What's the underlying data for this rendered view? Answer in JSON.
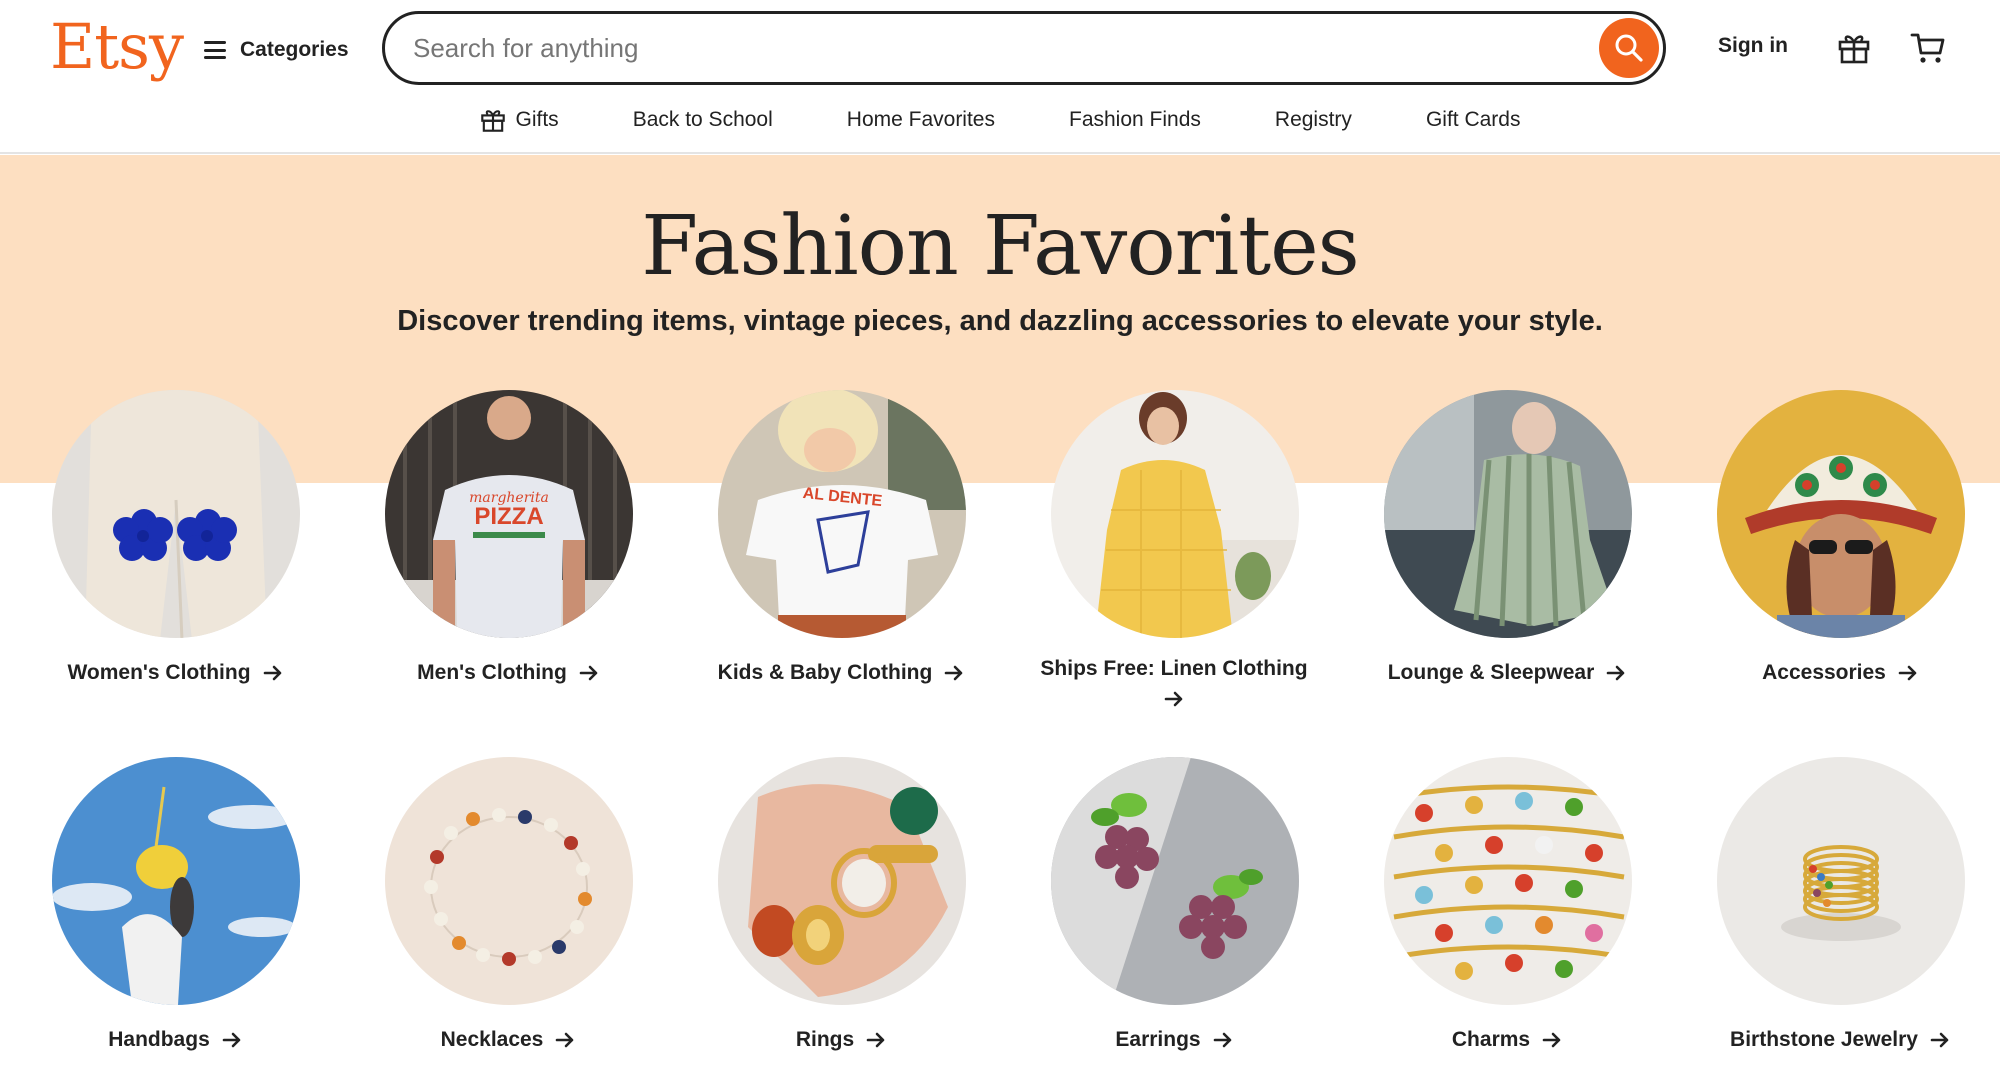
{
  "header": {
    "logo": "Etsy",
    "categories_label": "Categories",
    "search_placeholder": "Search for anything",
    "signin_label": "Sign in"
  },
  "subnav": {
    "items": [
      {
        "label": "Gifts",
        "icon": "gift-icon"
      },
      {
        "label": "Back to School"
      },
      {
        "label": "Home Favorites"
      },
      {
        "label": "Fashion Finds"
      },
      {
        "label": "Registry"
      },
      {
        "label": "Gift Cards"
      }
    ]
  },
  "hero": {
    "title": "Fashion Favorites",
    "subtitle": "Discover trending items, vintage pieces, and dazzling accessories to elevate your style."
  },
  "categories": [
    {
      "label": "Women's Clothing"
    },
    {
      "label": "Men's Clothing"
    },
    {
      "label": "Kids & Baby Clothing"
    },
    {
      "label": "Ships Free: Linen Clothing"
    },
    {
      "label": "Lounge & Sleepwear"
    },
    {
      "label": "Accessories"
    },
    {
      "label": "Handbags"
    },
    {
      "label": "Necklaces"
    },
    {
      "label": "Rings"
    },
    {
      "label": "Earrings"
    },
    {
      "label": "Charms"
    },
    {
      "label": "Birthstone Jewelry"
    }
  ],
  "colors": {
    "brand": "#f1641e",
    "hero_bg": "#fddfc1",
    "text": "#222222"
  }
}
